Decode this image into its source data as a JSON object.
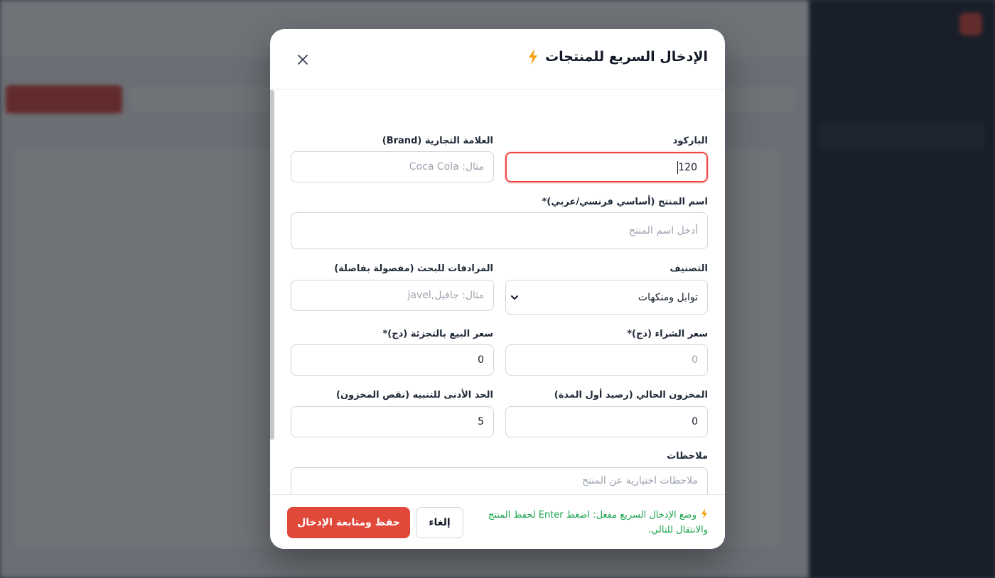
{
  "modal": {
    "title": "الإدخال السريع للمنتجات",
    "title_icon": "bolt-icon",
    "close_icon": "close-icon",
    "accent_color": "#e0483a",
    "bolt_color": "#f59e0b"
  },
  "fields": {
    "barcode": {
      "label": "الباركود",
      "value": "120"
    },
    "brand": {
      "label": "العلامة التجارية (Brand)",
      "placeholder": "مثال: Coca Cola"
    },
    "product_name": {
      "label": "اسم المنتج (أساسي فرنسي/عربي)*",
      "placeholder": "أدخل اسم المنتج"
    },
    "category": {
      "label": "التصنيف",
      "selected": "توابل ومنكهات"
    },
    "synonyms": {
      "label": "المرادفات للبحث (مفصولة بفاصلة)",
      "placeholder": "مثال: جافيل,javel"
    },
    "purchase_price": {
      "label": "سعر الشراء (دج)*",
      "placeholder": "0"
    },
    "retail_price": {
      "label": "سعر البيع بالتجزئة (دج)*",
      "value": "0"
    },
    "current_stock": {
      "label": "المخزون الحالي (رصيد أول المدة)",
      "value": "0"
    },
    "min_stock_alert": {
      "label": "الحد الأدنى للتنبيه (نقص المخزون)",
      "value": "5"
    },
    "notes": {
      "label": "ملاحظات",
      "placeholder": "ملاحظات اختيارية عن المنتج"
    }
  },
  "footer": {
    "hint": "وضع الإدخال السريع مفعل: اضغط Enter لحفظ المنتج والانتقال للتالي.",
    "cancel_label": "إلغاء",
    "save_label": "حفظ ومتابعة الإدخال",
    "hint_color": "#16a34a"
  }
}
